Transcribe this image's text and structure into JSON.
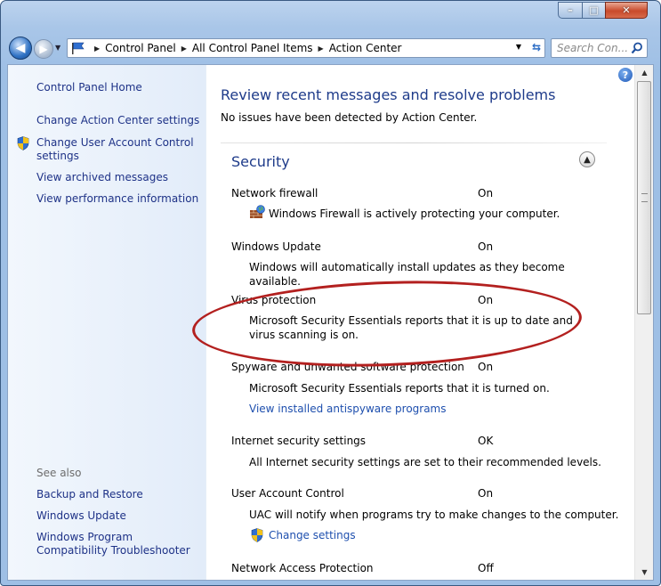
{
  "window": {
    "controls": {
      "minimize": "–",
      "maximize": "□",
      "close": "✕"
    }
  },
  "nav": {
    "breadcrumbs": [
      "Control Panel",
      "All Control Panel Items",
      "Action Center"
    ],
    "search_placeholder": "Search Con..."
  },
  "sidebar": {
    "items": [
      {
        "label": "Control Panel Home"
      },
      {
        "label": "Change Action Center settings"
      },
      {
        "label": "Change User Account Control settings",
        "shield": true
      },
      {
        "label": "View archived messages"
      },
      {
        "label": "View performance information"
      }
    ],
    "see_also_label": "See also",
    "see_also": [
      {
        "label": "Backup and Restore"
      },
      {
        "label": "Windows Update"
      },
      {
        "label": "Windows Program Compatibility Troubleshooter"
      }
    ]
  },
  "main": {
    "heading": "Review recent messages and resolve problems",
    "subheading": "No issues have been detected by Action Center.",
    "security": {
      "title": "Security",
      "rows": [
        {
          "label": "Network firewall",
          "status": "On",
          "desc": "Windows Firewall is actively protecting your computer."
        },
        {
          "label": "Windows Update",
          "status": "On",
          "desc": "Windows will automatically install updates as they become available."
        },
        {
          "label": "Virus protection",
          "status": "On",
          "desc": "Microsoft Security Essentials reports that it is up to date and virus scanning is on."
        },
        {
          "label": "Spyware and unwanted software protection",
          "status": "On",
          "desc": "Microsoft Security Essentials reports that it is turned on.",
          "link": "View installed antispyware programs"
        },
        {
          "label": "Internet security settings",
          "status": "OK",
          "desc": "All Internet security settings are set to their recommended levels."
        },
        {
          "label": "User Account Control",
          "status": "On",
          "desc": "UAC will notify when programs try to make changes to the computer.",
          "link": "Change settings"
        },
        {
          "label": "Network Access Protection",
          "status": "Off"
        }
      ]
    }
  },
  "colors": {
    "annotation_oval": "#b3201f",
    "link": "#1e3287",
    "heading": "#1e3b8a"
  }
}
